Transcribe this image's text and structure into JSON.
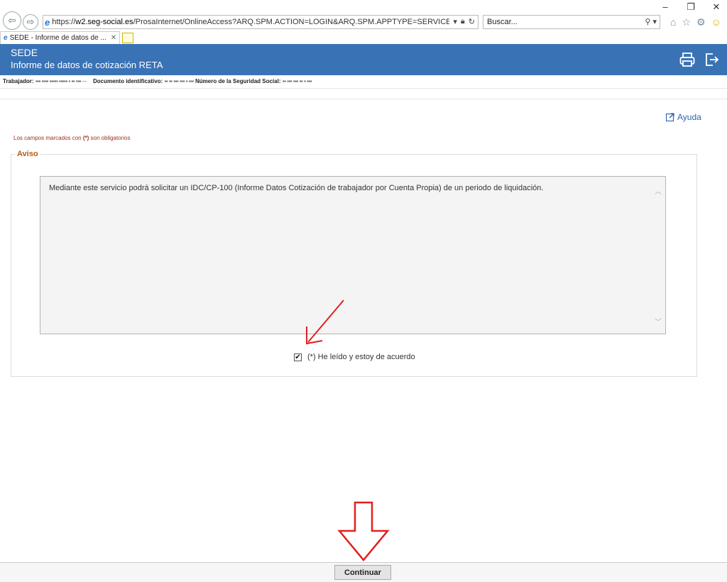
{
  "browser": {
    "window_controls": [
      "–",
      "❐",
      "✕"
    ],
    "url_prefix": "https://",
    "url_domain": "w2.seg-social.es",
    "url_path": "/ProsaInternet/OnlineAccess?ARQ.SPM.ACTION=LOGIN&ARQ.SPM.APPTYPE=SERVICE&ARQ.IDAPP=AFHG",
    "search_placeholder": "Buscar...",
    "tab_title": "SEDE - Informe de datos de ...",
    "tab_close": "✕"
  },
  "header": {
    "title": "SEDE",
    "subtitle": "Informe de datos de cotización RETA",
    "color": "#3a73b5"
  },
  "worker": {
    "trabajador_label": "Trabajador:",
    "trabajador_value": "▪▪▪ ▪▪▪▪ ▪▪▪▪▪ ▪▪▪▪▪ ▪ ▪▪ ▪▪▪ ---",
    "documento_label": "Documento identificativo:",
    "documento_value": "▪▪ ▪▪ ▪▪▪ ▪▪▪ ▪ ▪▪▪",
    "nss_label": "Número de la Seguridad Social:",
    "nss_value": "▪▪ ▪▪▪ ▪▪▪ ▪▪ ▪ ▪▪▪"
  },
  "help_label": "Ayuda",
  "required_note": {
    "before": "Los campos marcados con",
    "marker": "(*)",
    "after": "son obligatorios"
  },
  "aviso": {
    "legend": "Aviso",
    "text": "Mediante este servicio podrá solicitar un IDC/CP-100 (Informe Datos Cotización de trabajador por Cuenta Propia) de un periodo de liquidación."
  },
  "agreement": {
    "checked": true,
    "check_glyph": "✔",
    "label": "(*) He leído y estoy de acuerdo"
  },
  "continue_label": "Continuar",
  "annotation_color": "#e02020"
}
